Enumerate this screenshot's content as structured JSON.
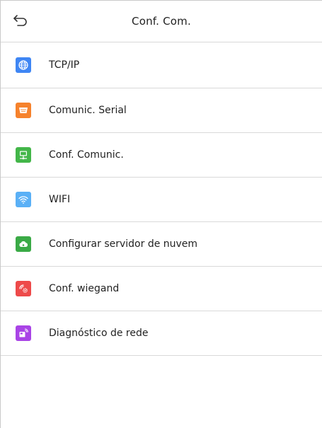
{
  "header": {
    "title": "Conf. Com.",
    "back_icon": "return-arrow-icon"
  },
  "menu": {
    "items": [
      {
        "label": "TCP/IP",
        "icon": "globe-icon",
        "color": "#3f86f4"
      },
      {
        "label": "Comunic. Serial",
        "icon": "serial-port-icon",
        "color": "#f6822c"
      },
      {
        "label": "Conf. Comunic.",
        "icon": "monitor-network-icon",
        "color": "#43b649"
      },
      {
        "label": "WIFI",
        "icon": "wifi-icon",
        "color": "#5ab0f6"
      },
      {
        "label": "Configurar servidor de nuvem",
        "icon": "cloud-icon",
        "color": "#3aaa46"
      },
      {
        "label": "Conf. wiegand",
        "icon": "wiegand-gear-icon",
        "color": "#ee4a4a"
      },
      {
        "label": "Diagnóstico de rede",
        "icon": "network-diagnosis-icon",
        "color": "#a944e6"
      }
    ]
  }
}
